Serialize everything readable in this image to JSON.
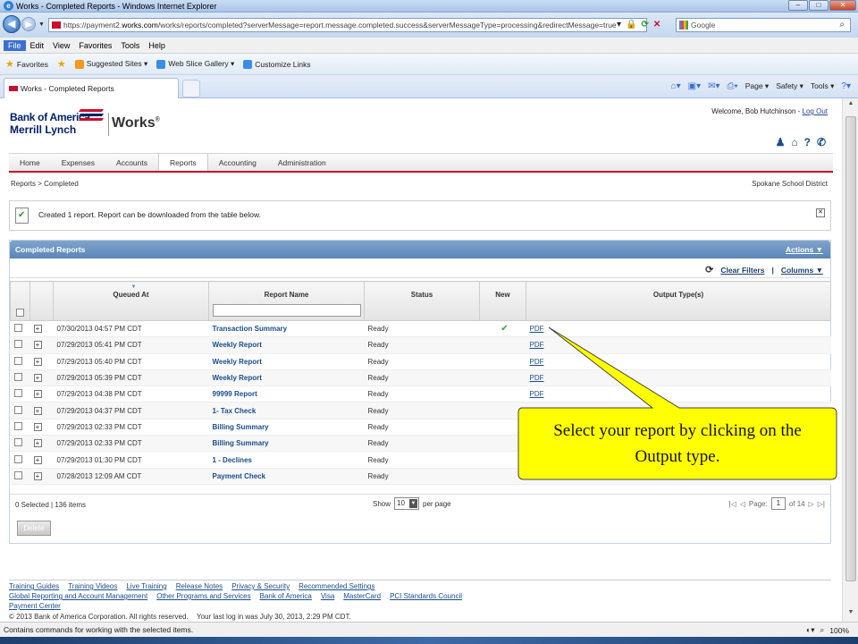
{
  "window": {
    "title": "Works - Completed Reports - Windows Internet Explorer"
  },
  "address": {
    "url_prefix": "https://payment2.",
    "url_host": "works.com",
    "url_path": "/works/reports/completed?serverMessage=report.message.completed.success&serverMessageType=processing&redirectMessage=true",
    "search_placeholder": "Google"
  },
  "menu": [
    "File",
    "Edit",
    "View",
    "Favorites",
    "Tools",
    "Help"
  ],
  "favorites": {
    "label": "Favorites",
    "items": [
      "Suggested Sites ▾",
      "Web Slice Gallery ▾",
      "Customize Links"
    ]
  },
  "tab": {
    "label": "Works - Completed Reports"
  },
  "commandbar": [
    "Page ▾",
    "Safety ▾",
    "Tools ▾"
  ],
  "header": {
    "brand_line1": "Bank of America",
    "brand_line2": "Merrill Lynch",
    "product": "Works",
    "product_mark": "®",
    "welcome": "Welcome, Bob Hutchinson -",
    "logout": "Log Out"
  },
  "nav": [
    "Home",
    "Expenses",
    "Accounts",
    "Reports",
    "Accounting",
    "Administration"
  ],
  "breadcrumb": "Reports  >  Completed",
  "district": "Spokane School District",
  "message": "Created 1 report. Report can be downloaded from the table below.",
  "panel": {
    "title": "Completed Reports",
    "actions": "Actions ▼",
    "clear_filters": "Clear Filters",
    "columns": "Columns ▼"
  },
  "table": {
    "headers": [
      "Queued At",
      "Report Name",
      "Status",
      "New",
      "Output Type(s)"
    ],
    "rows": [
      {
        "queued": "07/30/2013 04:57 PM CDT",
        "name": "Transaction Summary",
        "status": "Ready",
        "new": "✔",
        "output": "PDF"
      },
      {
        "queued": "07/29/2013 05:41 PM CDT",
        "name": "Weekly Report",
        "status": "Ready",
        "new": "",
        "output": "PDF"
      },
      {
        "queued": "07/29/2013 05:40 PM CDT",
        "name": "Weekly Report",
        "status": "Ready",
        "new": "",
        "output": "PDF"
      },
      {
        "queued": "07/29/2013 05:39 PM CDT",
        "name": "Weekly Report",
        "status": "Ready",
        "new": "",
        "output": "PDF"
      },
      {
        "queued": "07/29/2013 04:38 PM CDT",
        "name": "99999 Report",
        "status": "Ready",
        "new": "",
        "output": "PDF"
      },
      {
        "queued": "07/29/2013 04:37 PM CDT",
        "name": "1- Tax Check",
        "status": "Ready",
        "new": "",
        "output": ""
      },
      {
        "queued": "07/29/2013 02:33 PM CDT",
        "name": "Billing Summary",
        "status": "Ready",
        "new": "",
        "output": ""
      },
      {
        "queued": "07/29/2013 02:33 PM CDT",
        "name": "Billing Summary",
        "status": "Ready",
        "new": "",
        "output": ""
      },
      {
        "queued": "07/29/2013 01:30 PM CDT",
        "name": "1 - Declines",
        "status": "Ready",
        "new": "",
        "output": ""
      },
      {
        "queued": "07/28/2013 12:09 AM CDT",
        "name": "Payment Check",
        "status": "Ready",
        "new": "",
        "output": ""
      }
    ]
  },
  "pager": {
    "selected": "0 Selected | 136 items",
    "show": "Show",
    "per_page_value": "10",
    "per_page": "per page",
    "page_label": "Page:",
    "page_value": "1",
    "of_pages": "of 14"
  },
  "delete_label": "Delete",
  "footer": {
    "links": [
      "Training Guides",
      "Training Videos",
      "Live Training",
      "Release Notes",
      "Privacy & Security",
      "Recommended Settings",
      "Global Reporting and Account Management",
      "Other Programs and Services",
      "Bank of America",
      "Visa",
      "MasterCard",
      "PCI Standards Council",
      "Payment Center"
    ],
    "copyright": "© 2013 Bank of America Corporation. All rights reserved.",
    "last_login": "Your last log in was July 30, 2013, 2:29 PM CDT."
  },
  "callout": {
    "text": "Select your report by clicking on the Output type."
  },
  "status": {
    "text": "Contains commands for working with the selected items.",
    "zoom": "100%"
  },
  "colors": {
    "brand_blue": "#012169",
    "brand_red": "#c8102e",
    "callout_fill": "#ffff00"
  }
}
